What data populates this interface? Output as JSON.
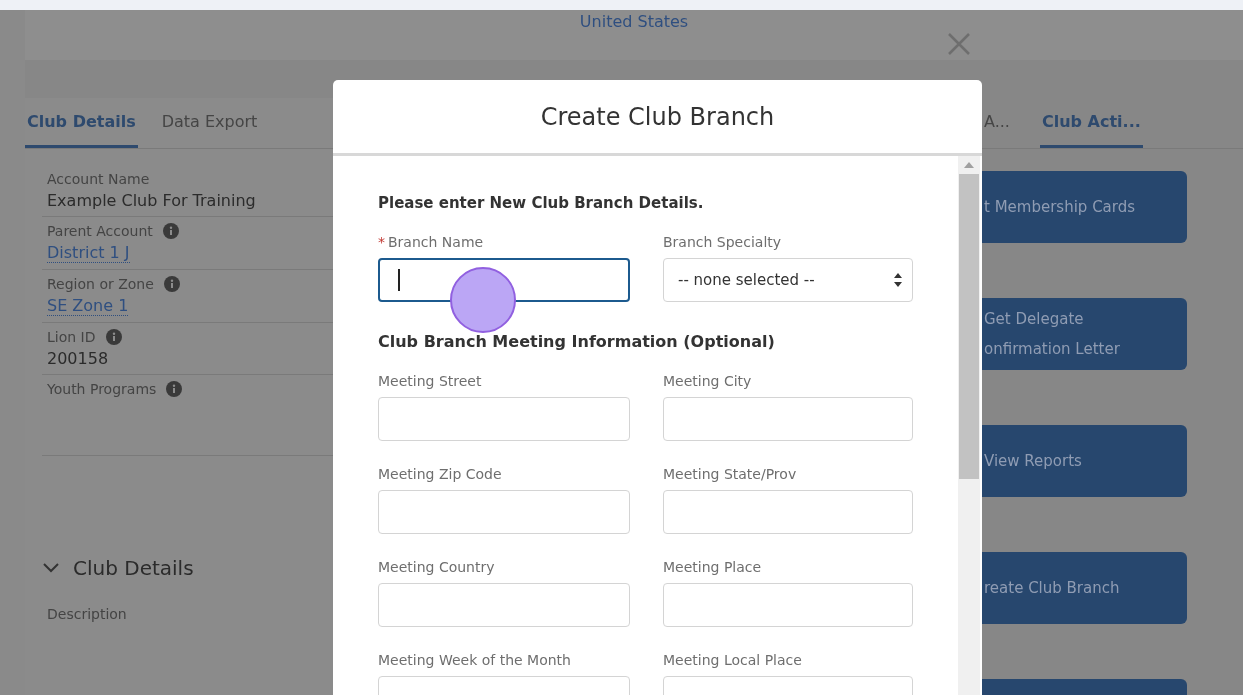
{
  "page_header": {
    "country": "United States"
  },
  "left_tabs": [
    {
      "label": "Club Details",
      "selected": true
    },
    {
      "label": "Data Export",
      "selected": false
    }
  ],
  "right_tabs": [
    {
      "label": "A...",
      "selected": false
    },
    {
      "label": "Club Acti...",
      "selected": true
    }
  ],
  "account_fields": [
    {
      "label": "Account Name",
      "info": false,
      "kind": "text",
      "value": "Example Club For Training"
    },
    {
      "label": "Parent Account",
      "info": true,
      "kind": "link",
      "value": "District 1 J"
    },
    {
      "label": "Region or Zone",
      "info": true,
      "kind": "link",
      "value": "SE Zone 1"
    },
    {
      "label": "Lion ID",
      "info": true,
      "kind": "text",
      "value": "200158"
    },
    {
      "label": "Youth Programs",
      "info": true,
      "kind": "empty"
    }
  ],
  "section": {
    "title": "Club Details",
    "expanded": true
  },
  "description_label": "Description",
  "action_buttons": [
    {
      "lines": [
        "t Membership Cards"
      ]
    },
    {
      "lines": [
        "Get Delegate",
        "onfirmation Letter"
      ]
    },
    {
      "lines": [
        "View Reports"
      ]
    },
    {
      "lines": [
        "reate Club Branch"
      ]
    }
  ],
  "modal": {
    "title": "Create Club Branch",
    "intro": "Please enter New Club Branch Details.",
    "branch_name": {
      "label": "Branch Name",
      "required_mark": "*",
      "focused": true
    },
    "branch_specialty": {
      "label": "Branch Specialty",
      "value": "-- none selected --"
    },
    "meeting_heading": "Club Branch Meeting Information (Optional)",
    "meeting_fields": [
      "Meeting Street",
      "Meeting City",
      "Meeting Zip Code",
      "Meeting State/Prov",
      "Meeting Country",
      "Meeting Place",
      "Meeting Week of the Month",
      "Meeting Local Place"
    ]
  }
}
